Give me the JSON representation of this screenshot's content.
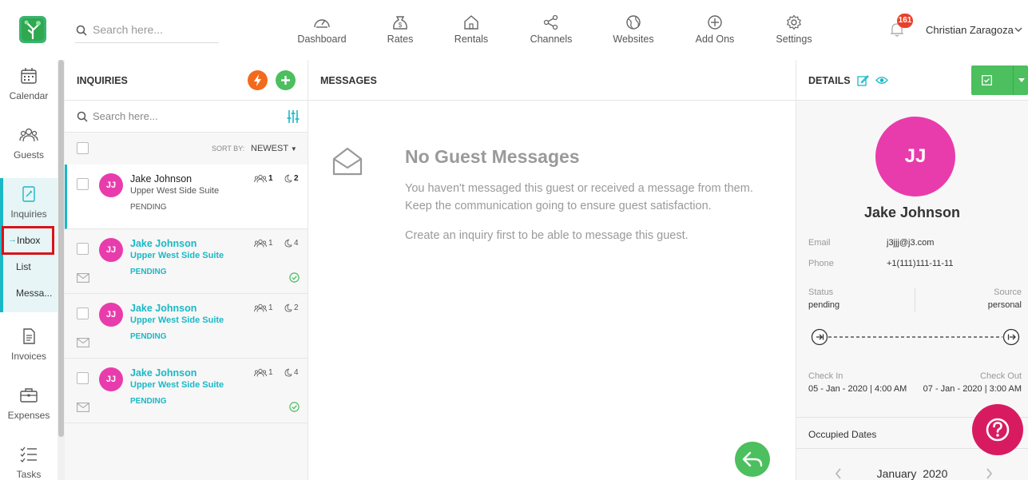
{
  "header": {
    "search_placeholder": "Search here...",
    "nav": [
      {
        "label": "Dashboard",
        "icon": "gauge-icon"
      },
      {
        "label": "Rates",
        "icon": "money-bag-icon"
      },
      {
        "label": "Rentals",
        "icon": "house-icon"
      },
      {
        "label": "Channels",
        "icon": "share-icon"
      },
      {
        "label": "Websites",
        "icon": "globe-icon"
      },
      {
        "label": "Add Ons",
        "icon": "plus-circle-icon"
      },
      {
        "label": "Settings",
        "icon": "gear-icon"
      }
    ],
    "notification_count": "161",
    "user_name": "Christian Zaragoza"
  },
  "sidebar": {
    "items": [
      {
        "label": "Calendar",
        "icon": "calendar-icon"
      },
      {
        "label": "Guests",
        "icon": "guests-icon"
      },
      {
        "label": "Inquiries",
        "icon": "edit-document-icon"
      },
      {
        "label": "Invoices",
        "icon": "invoice-icon"
      },
      {
        "label": "Expenses",
        "icon": "briefcase-icon"
      },
      {
        "label": "Tasks",
        "icon": "checklist-icon"
      }
    ],
    "sub_items": [
      "Inbox",
      "List",
      "Messa..."
    ],
    "active_sub_arrow": "→"
  },
  "inquiries": {
    "title": "INQUIRIES",
    "search_placeholder": "Search here...",
    "sort_label": "SORT BY:",
    "sort_value": "NEWEST",
    "rows": [
      {
        "initials": "JJ",
        "name": "Jake Johnson",
        "property": "Upper West Side Suite",
        "status": "PENDING",
        "guests": "1",
        "nights": "2",
        "selected": true,
        "unread": false,
        "confirmed": false
      },
      {
        "initials": "JJ",
        "name": "Jake Johnson",
        "property": "Upper West Side Suite",
        "status": "PENDING",
        "guests": "1",
        "nights": "4",
        "selected": false,
        "unread": true,
        "confirmed": true
      },
      {
        "initials": "JJ",
        "name": "Jake Johnson",
        "property": "Upper West Side Suite",
        "status": "PENDING",
        "guests": "1",
        "nights": "2",
        "selected": false,
        "unread": true,
        "confirmed": false
      },
      {
        "initials": "JJ",
        "name": "Jake Johnson",
        "property": "Upper West Side Suite",
        "status": "PENDING",
        "guests": "1",
        "nights": "4",
        "selected": false,
        "unread": true,
        "confirmed": true
      }
    ]
  },
  "messages": {
    "title": "MESSAGES",
    "empty_title": "No Guest Messages",
    "empty_line1": "You haven't messaged this guest or received a message from them.",
    "empty_line2": "Keep the communication going to ensure guest satisfaction.",
    "empty_line3": "Create an inquiry first to be able to message this guest."
  },
  "details": {
    "title": "DETAILS",
    "initials": "JJ",
    "name": "Jake Johnson",
    "email_label": "Email",
    "email": "j3jjj@j3.com",
    "phone_label": "Phone",
    "phone": "+1(111)111-11-11",
    "status_label": "Status",
    "status": "pending",
    "source_label": "Source",
    "source": "personal",
    "check_in_label": "Check In",
    "check_in": "05 - Jan - 2020 | 4:00 AM",
    "check_out_label": "Check Out",
    "check_out": "07 - Jan - 2020 | 3:00 AM",
    "occupied_label": "Occupied Dates",
    "month": "January",
    "year": "2020"
  },
  "colors": {
    "accent": "#1ab8c6",
    "green": "#4cbf5e",
    "orange": "#f26b1d",
    "avatar": "#e93cac",
    "help": "#d81b60",
    "badge": "#e8412b",
    "highlight_box": "#d9141a"
  }
}
